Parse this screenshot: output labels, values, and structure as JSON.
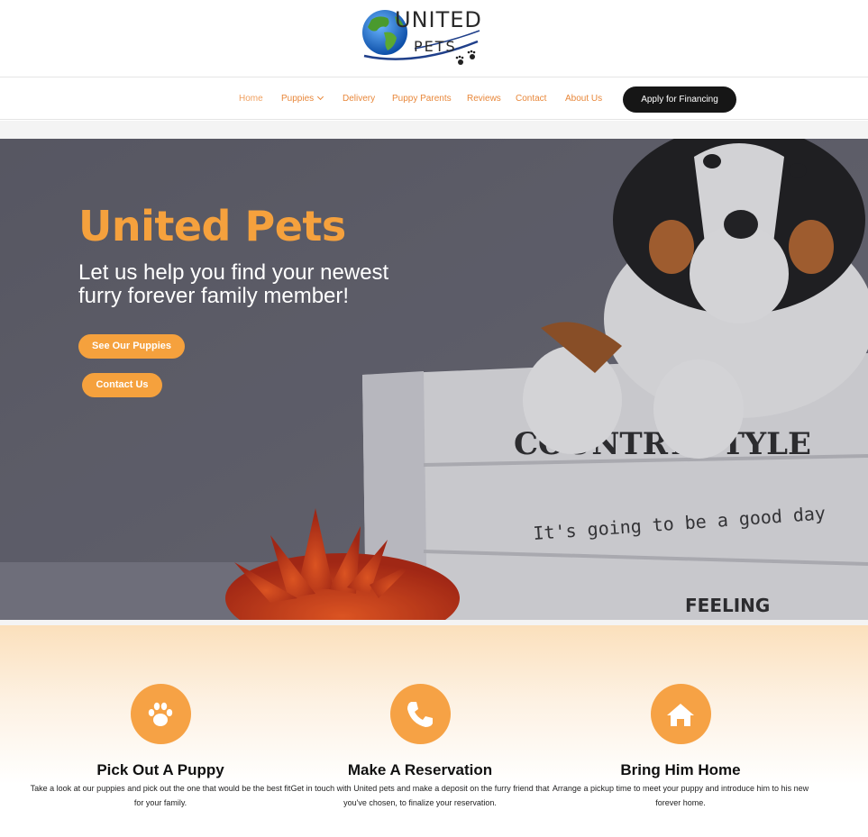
{
  "brand": {
    "line1": "UNITED",
    "line2": "PETS"
  },
  "nav": {
    "items": [
      "Home",
      "Puppies",
      "Delivery",
      "Puppy Parents",
      "Reviews",
      "Contact",
      "About Us"
    ],
    "apply_label": "Apply for Financing"
  },
  "hero": {
    "title": "United Pets",
    "subtitle": "Let us help you find your newest furry forever family member!",
    "button_primary": "See Our Puppies",
    "button_secondary": "Contact Us",
    "crate_text_1": "COUNTRY STYLE",
    "crate_text_2": "It's going to be a good day",
    "crate_text_3": "FEELING"
  },
  "steps": [
    {
      "icon": "paw-icon",
      "title": "Pick Out A Puppy",
      "text": "Take a look at our puppies and pick out the one that would be the best fit for your family."
    },
    {
      "icon": "phone-icon",
      "title": "Make A Reservation",
      "text": "Get in touch with United pets and make a deposit on the furry friend that you've chosen, to finalize your reservation."
    },
    {
      "icon": "home-icon",
      "title": "Bring Him Home",
      "text": "Arrange a pickup time to meet your puppy and introduce him to his new forever home."
    }
  ],
  "colors": {
    "accent": "#f5a13d",
    "nav_text": "#e8873a",
    "dark_button": "#161616"
  }
}
